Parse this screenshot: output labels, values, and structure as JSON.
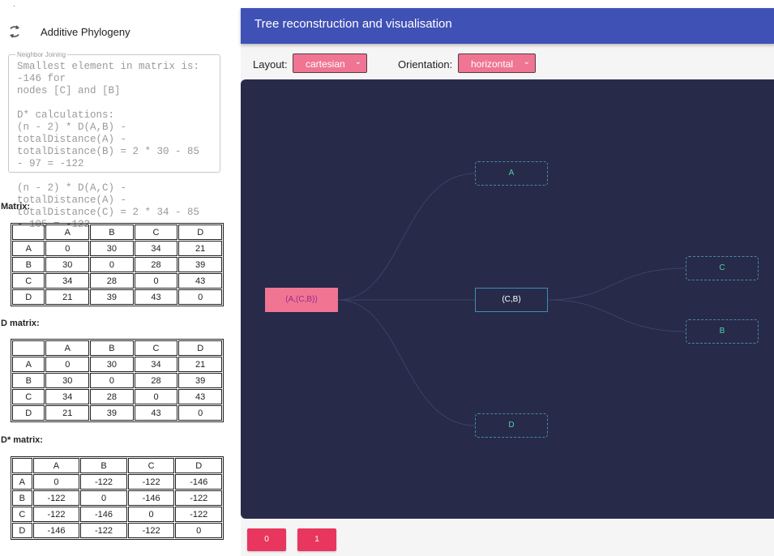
{
  "app": {
    "title": "Additive Phylogeny"
  },
  "neighbor_joining": {
    "legend": "Neighbor Joining",
    "text": "Smallest element in matrix is: -146 for\nnodes [C] and [B]\n\nD* calculations:\n(n - 2) * D(A,B) - totalDistance(A) -\ntotalDistance(B) = 2 * 30 - 85 - 97 = -122\n\n(n - 2) * D(A,C) - totalDistance(A) -\ntotalDistance(C) = 2 * 34 - 85 - 105 = -122"
  },
  "matrices": [
    {
      "label": "Matrix:",
      "headers": [
        "",
        "A",
        "B",
        "C",
        "D"
      ],
      "rows": [
        [
          "A",
          "0",
          "30",
          "34",
          "21"
        ],
        [
          "B",
          "30",
          "0",
          "28",
          "39"
        ],
        [
          "C",
          "34",
          "28",
          "0",
          "43"
        ],
        [
          "D",
          "21",
          "39",
          "43",
          "0"
        ]
      ]
    },
    {
      "label": "D matrix:",
      "headers": [
        "",
        "A",
        "B",
        "C",
        "D"
      ],
      "rows": [
        [
          "A",
          "0",
          "30",
          "34",
          "21"
        ],
        [
          "B",
          "30",
          "0",
          "28",
          "39"
        ],
        [
          "C",
          "34",
          "28",
          "0",
          "43"
        ],
        [
          "D",
          "21",
          "39",
          "43",
          "0"
        ]
      ]
    },
    {
      "label": "D* matrix:",
      "headers": [
        "",
        "A",
        "B",
        "C",
        "D"
      ],
      "rows": [
        [
          "A",
          "0",
          "-122",
          "-122",
          "-146"
        ],
        [
          "B",
          "-122",
          "0",
          "-146",
          "-122"
        ],
        [
          "C",
          "-122",
          "-146",
          "0",
          "-122"
        ],
        [
          "D",
          "-146",
          "-122",
          "-122",
          "0"
        ]
      ]
    }
  ],
  "viz": {
    "title": "Tree reconstruction and visualisation",
    "layout_label": "Layout:",
    "layout_value": "cartesian",
    "orientation_label": "Orientation:",
    "orientation_value": "horizontal"
  },
  "tree": {
    "nodes": {
      "root": "(A,(C,B))",
      "a": "A",
      "cb": "(C,B)",
      "d": "D",
      "c": "C",
      "b": "B"
    }
  },
  "steps": [
    "0",
    "1"
  ],
  "colors": {
    "header_bg": "#3f51b5",
    "select_bg": "#ef7593",
    "canvas_bg": "#272a49",
    "node_text": "#4fd2a8",
    "step_button": "#e8365f"
  }
}
